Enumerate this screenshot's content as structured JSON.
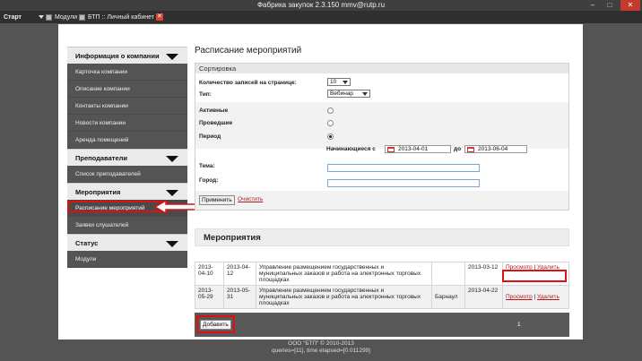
{
  "window": {
    "title": "Фабрика закупок 2.3.150 mmv@rutp.ru",
    "min": "–",
    "max": "□",
    "close": "✕"
  },
  "taskbar": {
    "start": "Старт",
    "modules": "Модули",
    "cabinet_tab": "БТП :: Личный кабинет"
  },
  "sidebar": {
    "sections": [
      {
        "title": "Информация о компании",
        "items": [
          "Карточка компании",
          "Описание компании",
          "Контакты компании",
          "Новости компании",
          "Аренда помещений"
        ]
      },
      {
        "title": "Преподаватели",
        "items": [
          "Список преподавателей"
        ]
      },
      {
        "title": "Мероприятия",
        "items": [
          "Расписание мероприятий",
          "Заявки слушателей"
        ]
      },
      {
        "title": "Статус",
        "items": [
          "Модули"
        ]
      }
    ]
  },
  "main": {
    "title": "Расписание мероприятий",
    "sort": {
      "legend": "Сортировка",
      "records_label": "Количество записей на странице:",
      "records_value": "10",
      "type_label": "Тип:",
      "type_value": "Вебинар",
      "active_label": "Активные",
      "past_label": "Проведшие",
      "period_label": "Период",
      "starting_label": "Начинающиеся с",
      "date_from": "2013-04-01",
      "to_label": "до",
      "date_to": "2013-06-04",
      "topic_label": "Тема:",
      "city_label": "Город:",
      "apply": "Применить",
      "clear": "Очистить"
    },
    "events_title": "Мероприятия",
    "events": [
      {
        "start": "2013-04-10",
        "end": "2013-04-12",
        "name": "Управление размещением государственных и муниципальных заказов и работа на электронных торговых площадках",
        "city": "",
        "created": "2013-03-12",
        "view": "Просмотр",
        "sep": "|",
        "delete": "Удалить"
      },
      {
        "start": "2013-05-29",
        "end": "2013-05-31",
        "name": "Управление размещением государственных и муниципальных заказов и работа на электронных торговых площадках",
        "city": "Барнаул",
        "created": "2013-04-22",
        "view": "Просмотр",
        "sep": "|",
        "delete": "Удалить"
      }
    ],
    "add_button": "Добавить",
    "page_number": "1"
  },
  "footer": {
    "copyright": "ООО \"БТП\" © 2010-2013",
    "debug": "queries=[11], time elapsed=[0.011299]"
  },
  "colors": {
    "highlight": "#e01010",
    "link": "#b31b1b",
    "sidebar_dark": "#545454"
  }
}
